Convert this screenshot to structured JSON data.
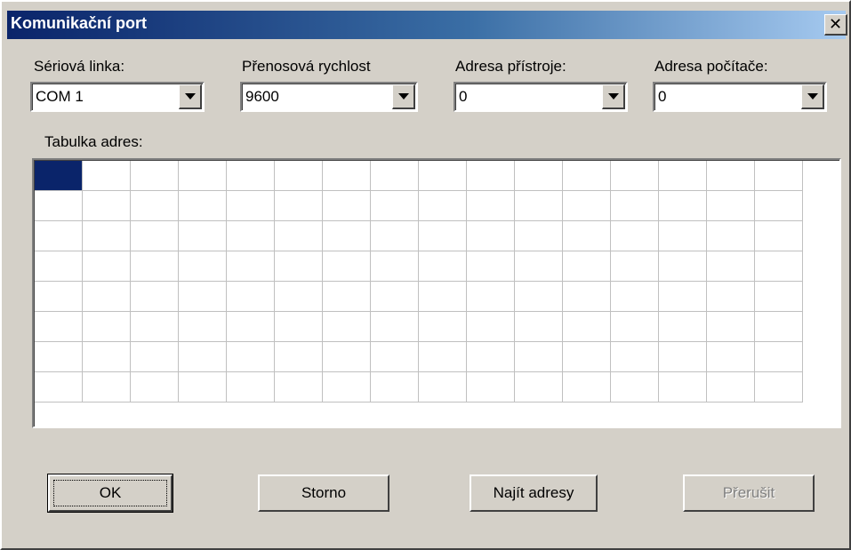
{
  "window": {
    "title": "Komunikační port"
  },
  "fields": {
    "serial_line": {
      "label": "Sériová linka:",
      "value": "COM 1"
    },
    "baud_rate": {
      "label": "Přenosová rychlost",
      "value": "9600"
    },
    "device_address": {
      "label": "Adresa přístroje:",
      "value": "0"
    },
    "computer_address": {
      "label": "Adresa počítače:",
      "value": "0"
    }
  },
  "address_table": {
    "label": "Tabulka adres:",
    "columns": 16,
    "rows": 8,
    "selected_cell": [
      0,
      0
    ]
  },
  "buttons": {
    "ok": "OK",
    "cancel": "Storno",
    "find": "Najít adresy",
    "abort": "Přerušit"
  }
}
